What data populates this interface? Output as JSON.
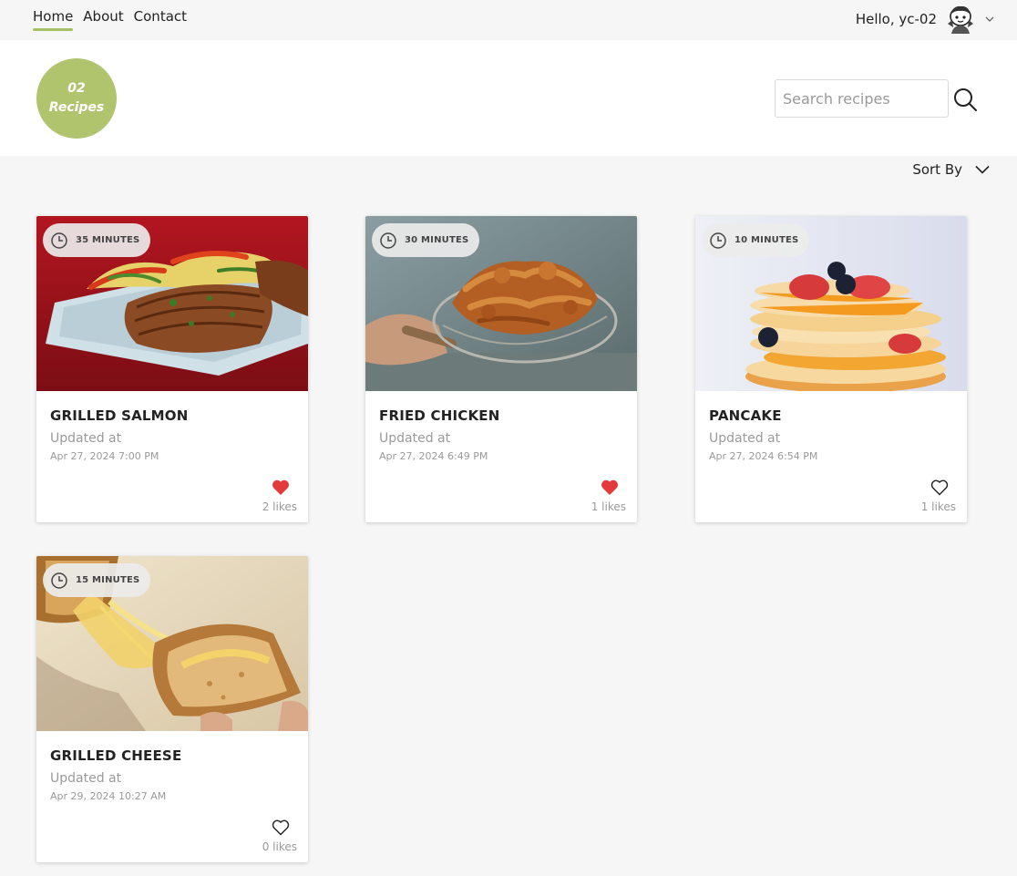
{
  "nav": {
    "links": [
      "Home",
      "About",
      "Contact"
    ],
    "active": "Home",
    "greeting": "Hello, yc-02"
  },
  "header": {
    "badge_number": "02",
    "badge_label": "Recipes",
    "search_placeholder": "Search recipes"
  },
  "sort": {
    "label": "Sort By"
  },
  "colors": {
    "accent": "#a5bf65",
    "badge": "#b0c46e",
    "liked": "#e33b3b"
  },
  "recipes": [
    {
      "time": "35 MINUTES",
      "title": "GRILLED SALMON",
      "updated_label": "Updated at",
      "updated": "Apr 27, 2024 7:00 PM",
      "liked": true,
      "likes": "2 likes"
    },
    {
      "time": "30 MINUTES",
      "title": "FRIED CHICKEN",
      "updated_label": "Updated at",
      "updated": "Apr 27, 2024 6:49 PM",
      "liked": true,
      "likes": "1 likes"
    },
    {
      "time": "10 MINUTES",
      "title": "PANCAKE",
      "updated_label": "Updated at",
      "updated": "Apr 27, 2024 6:54 PM",
      "liked": false,
      "likes": "1 likes"
    },
    {
      "time": "15 MINUTES",
      "title": "GRILLED CHEESE",
      "updated_label": "Updated at",
      "updated": "Apr 29, 2024 10:27 AM",
      "liked": false,
      "likes": "0 likes"
    }
  ]
}
